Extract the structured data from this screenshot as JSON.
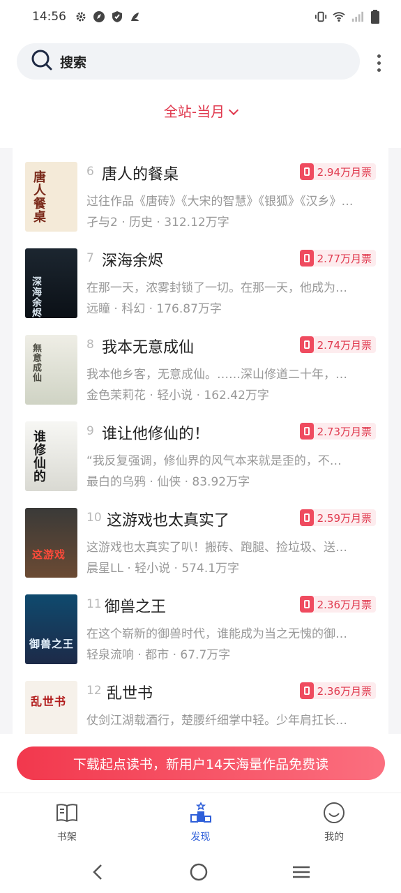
{
  "status_bar": {
    "time": "14:56",
    "left_icons": [
      "gear-icon",
      "compass-icon",
      "shield-icon",
      "bird-icon"
    ],
    "right_icons": [
      "vibrate-icon",
      "wifi-icon",
      "signal-icon",
      "battery-icon"
    ]
  },
  "header": {
    "search_label": "搜索",
    "filter_label": "全站-当月"
  },
  "books": [
    {
      "rank": "6",
      "title": "唐人的餐桌",
      "desc": "过往作品《唐砖》《大宋的智慧》《银狐》《汉乡》…",
      "meta": "孑与2 · 历史 · 312.12万字",
      "votes": "2.94万月票",
      "cover_text": "唐人餐桌"
    },
    {
      "rank": "7",
      "title": "深海余烬",
      "desc": "在那一天，浓雾封锁了一切。在那一天，他成为…",
      "meta": "远瞳 · 科幻 · 176.87万字",
      "votes": "2.77万月票",
      "cover_text": "深海余烬"
    },
    {
      "rank": "8",
      "title": "我本无意成仙",
      "desc": "我本他乡客，无意成仙。……深山修道二十年，…",
      "meta": "金色茉莉花 · 轻小说 · 162.42万字",
      "votes": "2.74万月票",
      "cover_text": "無意成仙"
    },
    {
      "rank": "9",
      "title": "谁让他修仙的！",
      "desc": "“我反复强调，修仙界的风气本来就是歪的，不…",
      "meta": "最白的乌鸦 · 仙侠 · 83.92万字",
      "votes": "2.73万月票",
      "cover_text": "谁修仙的"
    },
    {
      "rank": "10",
      "title": "这游戏也太真实了",
      "desc": "这游戏也太真实了叭！搬砖、跑腿、捡垃圾、送…",
      "meta": "晨星LL · 轻小说 · 574.1万字",
      "votes": "2.59万月票",
      "cover_text": "这游戏"
    },
    {
      "rank": "11",
      "title": "御兽之王",
      "desc": "在这个崭新的御兽时代，谁能成为当之无愧的御…",
      "meta": "轻泉流响 · 都市 · 67.7万字",
      "votes": "2.36万月票",
      "cover_text": "御兽之王"
    },
    {
      "rank": "12",
      "title": "乱世书",
      "desc": "仗剑江湖载酒行，楚腰纤细掌中轻。少年肩扛长…",
      "meta": "",
      "votes": "2.36万月票",
      "cover_text": "乱世书"
    }
  ],
  "partial_top": {
    "meta": "…"
  },
  "banner": {
    "text": "下载起点读书，新用户14天海量作品免费读"
  },
  "bottom_nav": [
    {
      "label": "书架",
      "icon": "book-icon",
      "active": false
    },
    {
      "label": "发现",
      "icon": "podium-icon",
      "active": true
    },
    {
      "label": "我的",
      "icon": "smiley-icon",
      "active": false
    }
  ],
  "colors": {
    "accent": "#e0394e",
    "active_blue": "#2f5fd9"
  }
}
